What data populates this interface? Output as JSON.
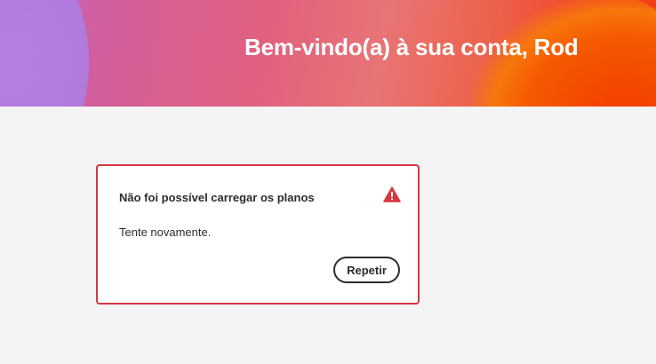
{
  "header": {
    "welcome_title": "Bem-vindo(a) à sua conta, Rod"
  },
  "error_card": {
    "heading": "Não foi possível carregar os planos",
    "message": "Tente novamente.",
    "retry_label": "Repetir",
    "alert_icon": "alert-triangle-icon",
    "border_color": "#d7373f"
  },
  "colors": {
    "page_background": "#f4f4f4",
    "hero_gradient_start": "#c063c2",
    "hero_gradient_end": "#f23c10"
  }
}
